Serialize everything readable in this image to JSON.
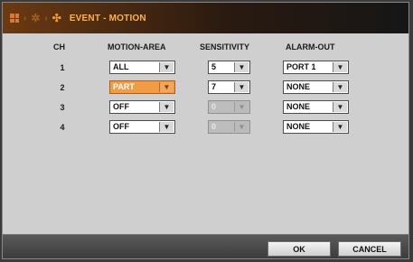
{
  "title": "EVENT - MOTION",
  "breadcrumb_icons": [
    "grid-icon",
    "gear-icon",
    "move-icon"
  ],
  "headers": {
    "ch": "CH",
    "motion_area": "MOTION-AREA",
    "sensitivity": "SENSITIVITY",
    "alarm_out": "ALARM-OUT"
  },
  "rows": [
    {
      "ch": "1",
      "motion_area": "ALL",
      "sensitivity": "5",
      "alarm_out": "PORT 1"
    },
    {
      "ch": "2",
      "motion_area": "PART",
      "sensitivity": "7",
      "alarm_out": "NONE"
    },
    {
      "ch": "3",
      "motion_area": "OFF",
      "sensitivity": "0",
      "alarm_out": "NONE"
    },
    {
      "ch": "4",
      "motion_area": "OFF",
      "sensitivity": "0",
      "alarm_out": "NONE"
    }
  ],
  "buttons": {
    "ok": "OK",
    "cancel": "CANCEL"
  },
  "colors": {
    "accent": "#f39a45",
    "title_text": "#ffb24a"
  }
}
